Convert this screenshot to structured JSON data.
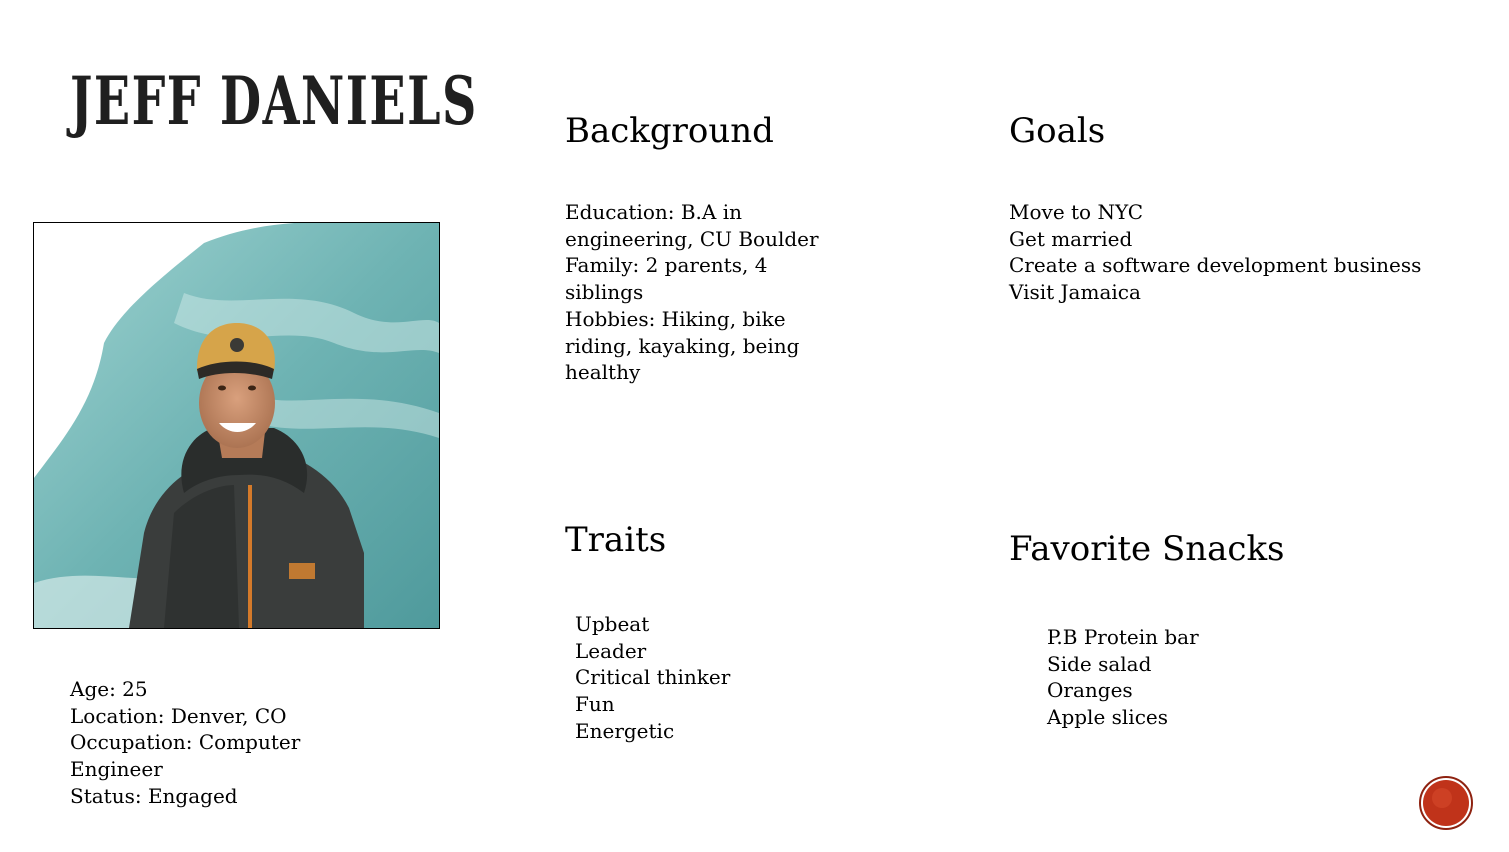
{
  "title": "JEFF DANIELS",
  "photo": {
    "subject": "portrait-photo"
  },
  "profile": {
    "lines": [
      "Age: 25",
      "Location: Denver, CO",
      "Occupation: Computer",
      "Engineer",
      "Status: Engaged"
    ]
  },
  "background": {
    "heading": "Background",
    "lines": [
      "Education: B.A in",
      "engineering, CU Boulder",
      "Family: 2 parents, 4",
      "siblings",
      "Hobbies: Hiking, bike",
      "riding, kayaking, being",
      "healthy"
    ]
  },
  "goals": {
    "heading": "Goals",
    "lines": [
      "Move to NYC",
      "Get married",
      "Create a software development business",
      "Visit Jamaica"
    ]
  },
  "traits": {
    "heading": "Traits",
    "lines": [
      "Upbeat",
      "Leader",
      "Critical thinker",
      "Fun",
      "Energetic"
    ]
  },
  "snacks": {
    "heading": "Favorite Snacks",
    "lines": [
      "P.B Protein bar",
      "Side salad",
      "Oranges",
      "Apple slices"
    ]
  },
  "colors": {
    "accent": "#c0331a",
    "accent_dark": "#8e2210",
    "photo_bg": "#6fb3b4"
  }
}
